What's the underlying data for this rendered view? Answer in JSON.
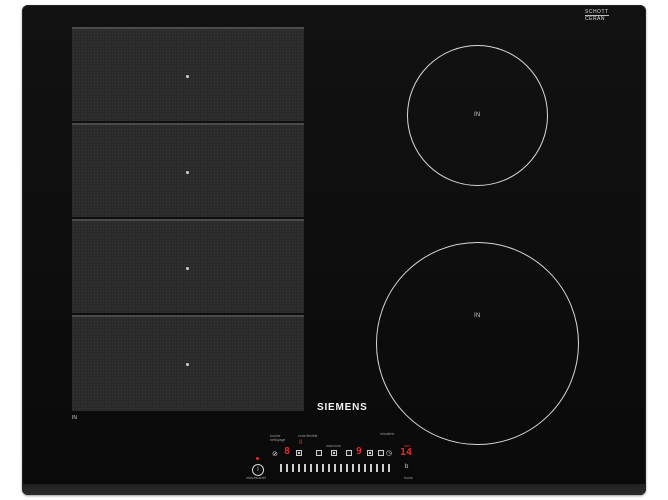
{
  "brand": "SIEMENS",
  "glass": {
    "line1": "SCHOTT",
    "line2": "CERAN"
  },
  "zones": {
    "left_label": "IN",
    "front_right_label": "IN",
    "rear_right_label": "IN"
  },
  "controls": {
    "label_flex": "zone flexible",
    "label_clean": "touche nettoyage",
    "label_max": "max'zone",
    "label_minuterie": "minuterie",
    "label_marche": "marche/arrêt",
    "label_boost": "boost",
    "display_left": "8",
    "display_mid": "9",
    "display_timer": "14",
    "display_top": "8",
    "minute_label": "min"
  },
  "icons": {
    "power": "power-icon",
    "timer": "clock-icon",
    "boost": "boost-icon",
    "lock": "child-lock-icon"
  },
  "colors": {
    "glass": "#121212",
    "display_red": "#e22a2a",
    "marking": "#d8d8d8"
  }
}
